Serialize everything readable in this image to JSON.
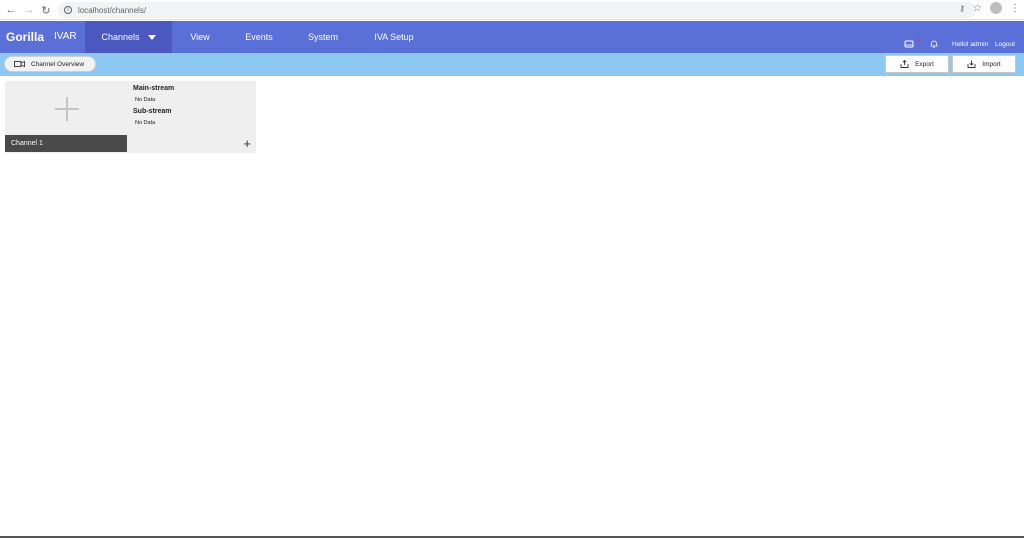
{
  "browser": {
    "url": "localhost/channels/"
  },
  "header": {
    "brand": "Gorilla",
    "product": "IVAR",
    "menu": [
      {
        "label": "Channels"
      },
      {
        "label": "View"
      },
      {
        "label": "Events"
      },
      {
        "label": "System"
      },
      {
        "label": "IVA Setup"
      }
    ],
    "greeting": "Hello! admin",
    "logout": "Logout",
    "colors": {
      "header": "#5b6fd9",
      "active_tab": "#4a58c0",
      "subbar": "#8cc8f2",
      "alert_dot": "#e53935"
    }
  },
  "toolbar": {
    "overview_label": "Channel Overview",
    "export_label": "Export",
    "import_label": "Import"
  },
  "channel_card": {
    "name": "Channel 1",
    "main_stream_title": "Main-stream",
    "main_stream_value": "No Data",
    "sub_stream_title": "Sub-stream",
    "sub_stream_value": "No Data"
  }
}
